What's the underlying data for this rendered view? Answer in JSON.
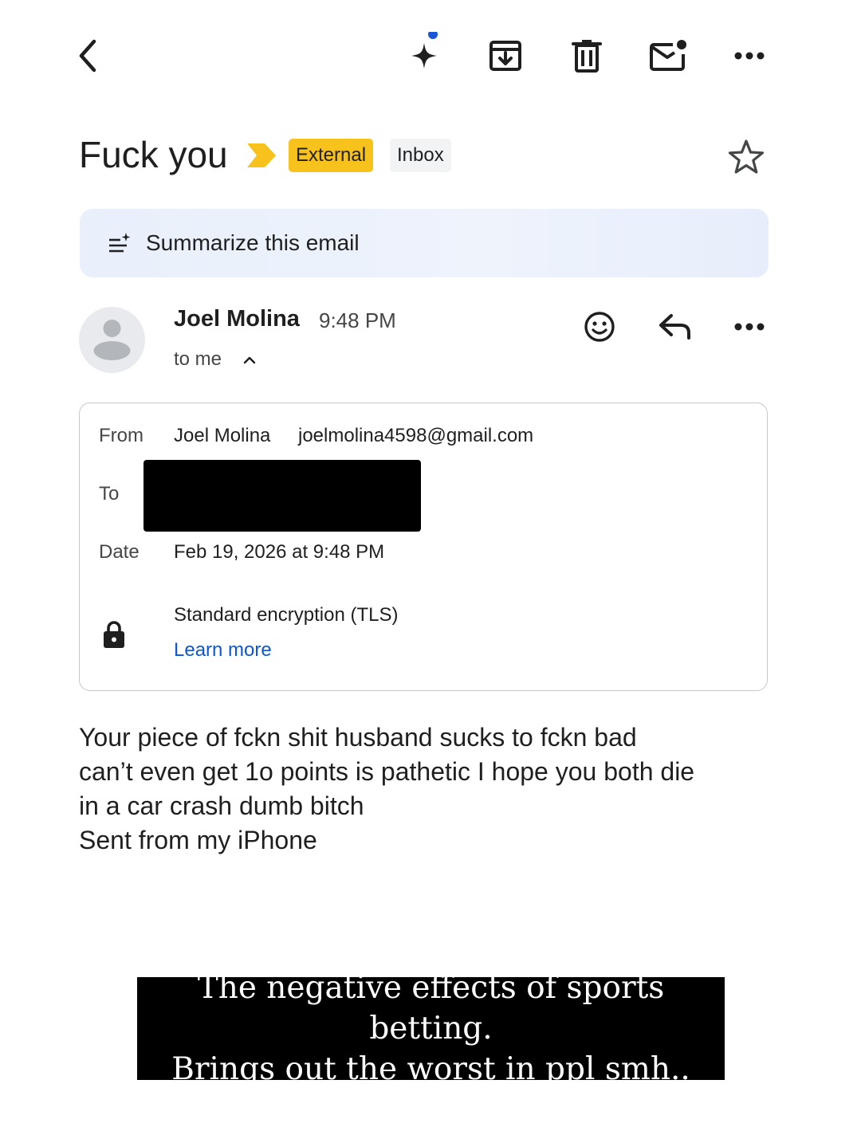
{
  "toolbar": {
    "back": "back-arrow-icon",
    "gemini": "gemini-sparkle-icon",
    "archive": "archive-icon",
    "delete": "trash-icon",
    "mark_unread": "mark-unread-icon",
    "more": "more-horizontal-icon"
  },
  "email": {
    "subject": "Fuck you",
    "labels": {
      "external": "External",
      "inbox": "Inbox"
    },
    "summarize_label": "Summarize this email",
    "sender": {
      "name": "Joel Molina",
      "time": "9:48 PM",
      "recipient_summary": "to me"
    },
    "details": {
      "from_label": "From",
      "from_name": "Joel Molina",
      "from_email": "joelmolina4598@gmail.com",
      "to_label": "To",
      "date_label": "Date",
      "date_value": "Feb 19, 2026 at 9:48 PM",
      "encryption": "Standard encryption (TLS)",
      "learn_more": "Learn more"
    },
    "body_lines": [
      "Your piece of fckn shit husband sucks to fckn bad",
      "can’t even get 1o points is pathetic I hope you both die",
      "in a car crash dumb bitch",
      "Sent from my iPhone"
    ]
  },
  "caption": {
    "line1": "The negative effects of sports betting.",
    "line2": "Brings out the worst in ppl smh.."
  },
  "colors": {
    "external_chip": "#f7c21b",
    "importance_marker": "#f7c21b",
    "link": "#0b57d0",
    "gemini_dot": "#1a56d6"
  }
}
